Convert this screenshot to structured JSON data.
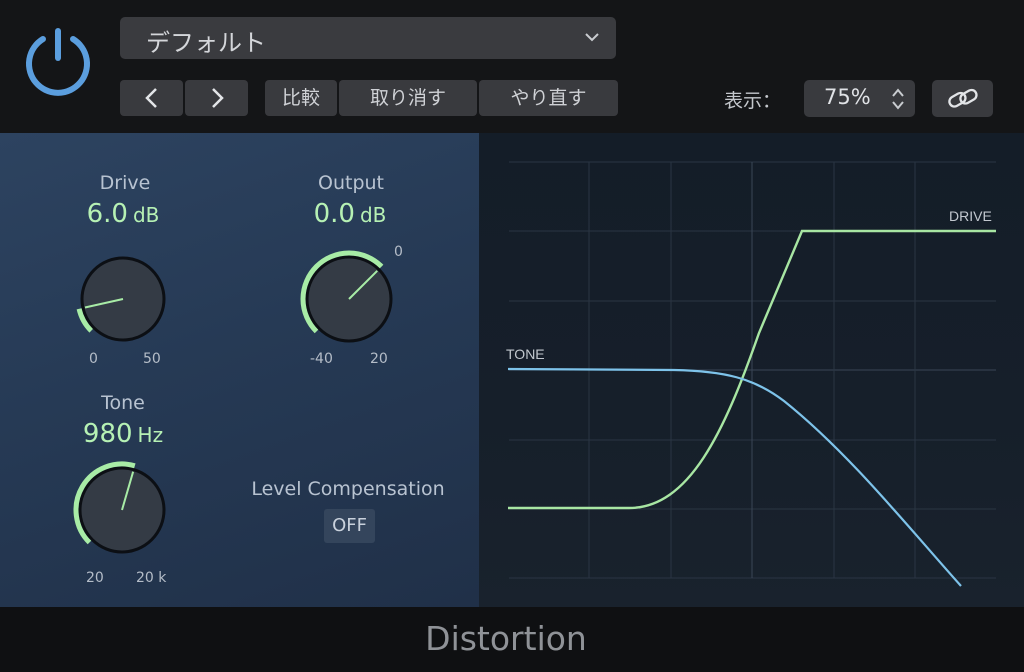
{
  "header": {
    "preset_name": "デフォルト",
    "compare_label": "比較",
    "undo_label": "取り消す",
    "redo_label": "やり直す",
    "view_label": "表示：",
    "zoom_value": "75%",
    "power_state": "on",
    "icons": [
      "power-icon",
      "chevron-down-icon",
      "chevron-left-icon",
      "chevron-right-icon",
      "stepper-arrows-icon",
      "link-icon"
    ]
  },
  "controls": {
    "drive": {
      "title": "Drive",
      "value": "6.0",
      "unit": "dB",
      "min_label": "0",
      "max_label": "50",
      "level": 0.12
    },
    "output": {
      "title": "Output",
      "value": "0.0",
      "unit": "dB",
      "min_label": "-40",
      "max_label": "20",
      "zero_label": "0",
      "level": 0.667
    },
    "tone": {
      "title": "Tone",
      "value": "980",
      "unit": "Hz",
      "min_label": "20",
      "max_label": "20 k",
      "level": 0.56
    },
    "level_compensation": {
      "title": "Level Compensation",
      "state": "OFF"
    }
  },
  "graph": {
    "drive_label": "DRIVE",
    "tone_label": "TONE"
  },
  "footer": {
    "plugin_name": "Distortion"
  },
  "colors": {
    "accent_green": "#b6f1b4",
    "tone_curve": "#7ec3ea",
    "power_blue": "#5b9ede",
    "panel_blue": "#2b405c"
  }
}
